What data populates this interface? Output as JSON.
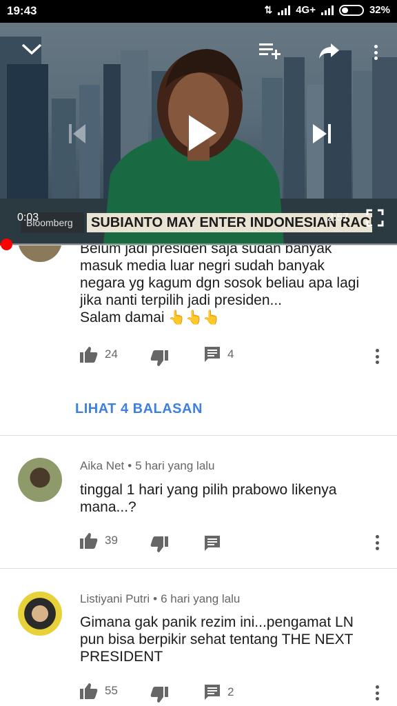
{
  "status_bar": {
    "time": "19:43",
    "network": "4G+",
    "battery": "32%"
  },
  "player": {
    "current_time": "0:03",
    "duration": "2:57",
    "progress": 0.017,
    "ticker_brand": "Bloomberg",
    "ticker_headline": "SUBIANTO MAY ENTER INDONESIAN RACE"
  },
  "comments": [
    {
      "text_lines": [
        "Belum jadi presiden saja sudah banyak",
        "masuk media luar negri sudah banyak",
        "negara yg kagum dgn sosok beliau apa lagi",
        "jika nanti terpilih jadi presiden...",
        "Salam damai"
      ],
      "emoji": "👆👆👆",
      "likes": "24",
      "replies": "4",
      "view_replies_label": "LIHAT 4 BALASAN"
    },
    {
      "author": "Aika Net",
      "time": "5 hari yang lalu",
      "text_lines": [
        "tinggal 1 hari yang pilih prabowo likenya",
        "mana...?"
      ],
      "likes": "39"
    },
    {
      "author": "Listiyani Putri",
      "time": "6 hari yang lalu",
      "text_lines": [
        "Gimana gak panik rezim ini...pengamat LN",
        "pun bisa berpikir sehat tentang THE NEXT",
        "PRESIDENT"
      ],
      "likes": "55",
      "replies": "2"
    }
  ],
  "colors": {
    "accent": "#3d80e0",
    "progress": "#ff0000"
  },
  "icons": [
    "chevron-down-icon",
    "add-to-playlist-icon",
    "share-icon",
    "more-vert-icon",
    "play-icon",
    "previous-icon",
    "next-icon",
    "fullscreen-icon",
    "thumb-up-icon",
    "thumb-down-icon",
    "comment-icon"
  ]
}
